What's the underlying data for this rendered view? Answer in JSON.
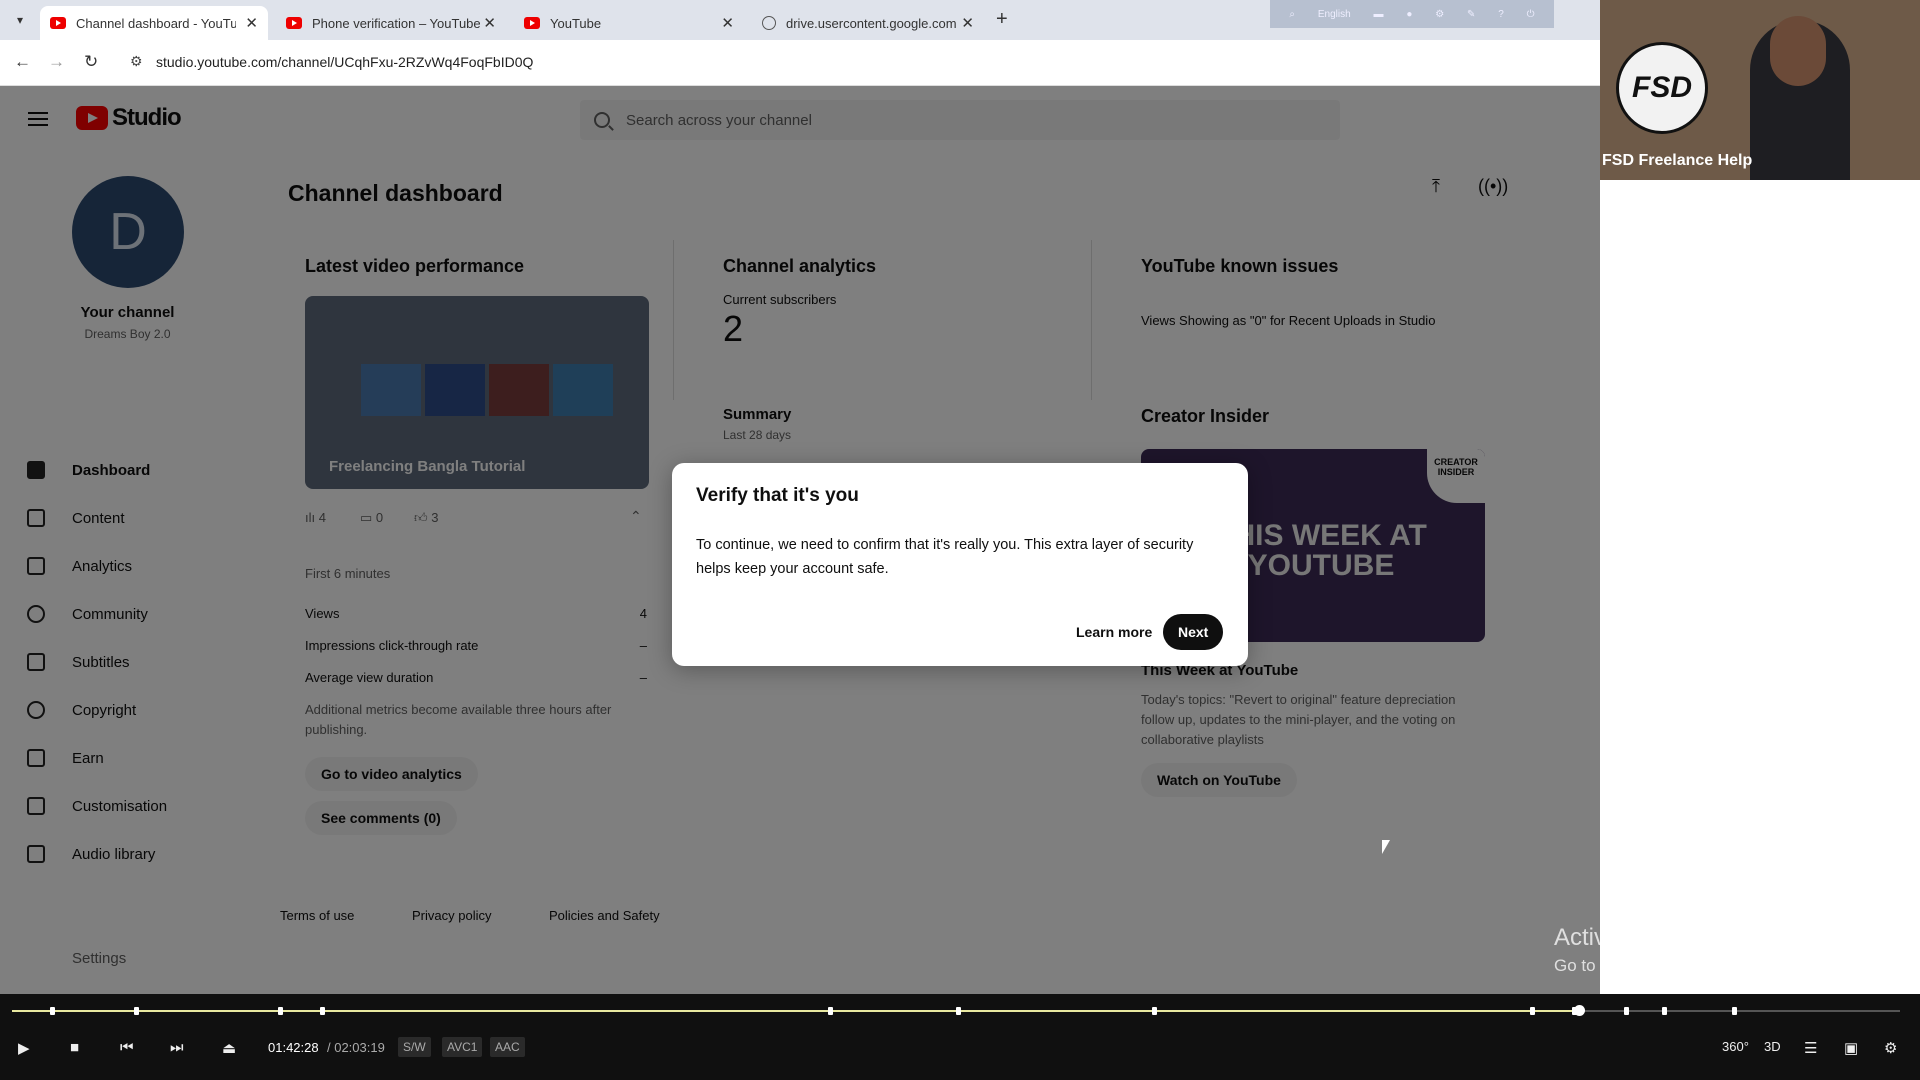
{
  "browser": {
    "tabs": [
      {
        "label": "Channel dashboard - YouTube",
        "icon": "youtube-icon",
        "active": true
      },
      {
        "label": "Phone verification – YouTube",
        "icon": "youtube-icon",
        "active": false
      },
      {
        "label": "YouTube",
        "icon": "youtube-icon",
        "active": false
      },
      {
        "label": "drive.usercontent.google.com",
        "icon": "globe-icon",
        "active": false
      }
    ],
    "url": "studio.youtube.com/channel/UCqhFxu-2RZvWq4FoqFbID0Q",
    "extension_language": "English"
  },
  "studio": {
    "logo_text": "Studio",
    "search_placeholder": "Search across your channel",
    "page_title": "Channel dashboard",
    "channel": {
      "avatar_letter": "D",
      "label": "Your channel",
      "name": "Dreams Boy 2.0"
    },
    "nav": [
      {
        "label": "Dashboard",
        "icon": "dashboard-icon"
      },
      {
        "label": "Content",
        "icon": "content-icon"
      },
      {
        "label": "Analytics",
        "icon": "analytics-icon"
      },
      {
        "label": "Community",
        "icon": "community-icon"
      },
      {
        "label": "Subtitles",
        "icon": "subtitles-icon"
      },
      {
        "label": "Copyright",
        "icon": "copyright-icon"
      },
      {
        "label": "Earn",
        "icon": "earn-icon"
      },
      {
        "label": "Customisation",
        "icon": "customisation-icon"
      },
      {
        "label": "Audio library",
        "icon": "audio-library-icon"
      }
    ],
    "settings_label": "Settings",
    "latest": {
      "heading": "Latest video performance",
      "video_title": "Freelancing Bangla Tutorial",
      "views_count": "4",
      "comments_count": "0",
      "likes_count": "3",
      "period": "First 6 minutes",
      "metrics": [
        {
          "label": "Views",
          "value": "4"
        },
        {
          "label": "Impressions click-through rate",
          "value": "–"
        },
        {
          "label": "Average view duration",
          "value": "–"
        }
      ],
      "note": "Additional metrics become available three hours after publishing.",
      "btn_analytics": "Go to video analytics",
      "btn_comments": "See comments (0)"
    },
    "analytics": {
      "heading": "Channel analytics",
      "subs_label": "Current subscribers",
      "subs_value": "2",
      "summary_heading": "Summary",
      "summary_period": "Last 28 days"
    },
    "known_issues": {
      "heading": "YouTube known issues",
      "item": "Views Showing as \"0\" for Recent Uploads in Studio"
    },
    "creator_insider": {
      "heading": "Creator Insider",
      "badge": "CREATOR INSIDER",
      "thumb_text": "THIS WEEK AT YOUTUBE",
      "title": "This Week at YouTube",
      "desc": "Today's topics: \"Revert to original\" feature depreciation follow up, updates to the mini-player, and the voting on collaborative playlists",
      "btn": "Watch on YouTube"
    },
    "footer": [
      "Terms of use",
      "Privacy policy",
      "Policies and Safety"
    ]
  },
  "modal": {
    "title": "Verify that it's you",
    "body": "To continue, we need to confirm that it's really you. This extra layer of security helps keep your account safe.",
    "learn_more": "Learn more",
    "next": "Next"
  },
  "webcam": {
    "label": "FSD Freelance Help",
    "logo": "FSD"
  },
  "watermark": {
    "line1": "Activate Windows",
    "line2": "Go to Settings to activate Windows."
  },
  "player": {
    "current_time": "01:42:28",
    "total_time": "/ 02:03:19",
    "tags": [
      "S/W",
      "AVC1",
      "AAC"
    ],
    "progress": 0.83,
    "right_labels": [
      "360°",
      "3D"
    ]
  }
}
